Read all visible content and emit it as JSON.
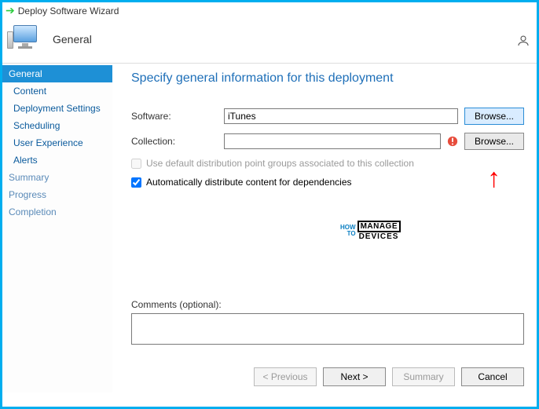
{
  "window": {
    "title": "Deploy Software Wizard"
  },
  "header": {
    "section": "General"
  },
  "sidebar": {
    "items": [
      {
        "label": "General",
        "selected": true,
        "level": 0
      },
      {
        "label": "Content",
        "selected": false,
        "level": 1
      },
      {
        "label": "Deployment Settings",
        "selected": false,
        "level": 1
      },
      {
        "label": "Scheduling",
        "selected": false,
        "level": 1
      },
      {
        "label": "User Experience",
        "selected": false,
        "level": 1
      },
      {
        "label": "Alerts",
        "selected": false,
        "level": 1
      },
      {
        "label": "Summary",
        "selected": false,
        "level": 0
      },
      {
        "label": "Progress",
        "selected": false,
        "level": 0
      },
      {
        "label": "Completion",
        "selected": false,
        "level": 0
      }
    ]
  },
  "page": {
    "heading": "Specify general information for this deployment",
    "software_label": "Software:",
    "software_value": "iTunes",
    "collection_label": "Collection:",
    "collection_value": "",
    "browse_label": "Browse...",
    "use_default_dp_label": "Use default distribution point groups associated to this collection",
    "use_default_dp_checked": false,
    "auto_distribute_label": "Automatically distribute content for dependencies",
    "auto_distribute_checked": true,
    "comments_label": "Comments (optional):",
    "comments_value": ""
  },
  "buttons": {
    "previous": "< Previous",
    "next": "Next >",
    "summary": "Summary",
    "cancel": "Cancel"
  },
  "watermark": {
    "how": "HOW",
    "to": "TO",
    "manage": "MANAGE",
    "devices": "DEVICES"
  }
}
